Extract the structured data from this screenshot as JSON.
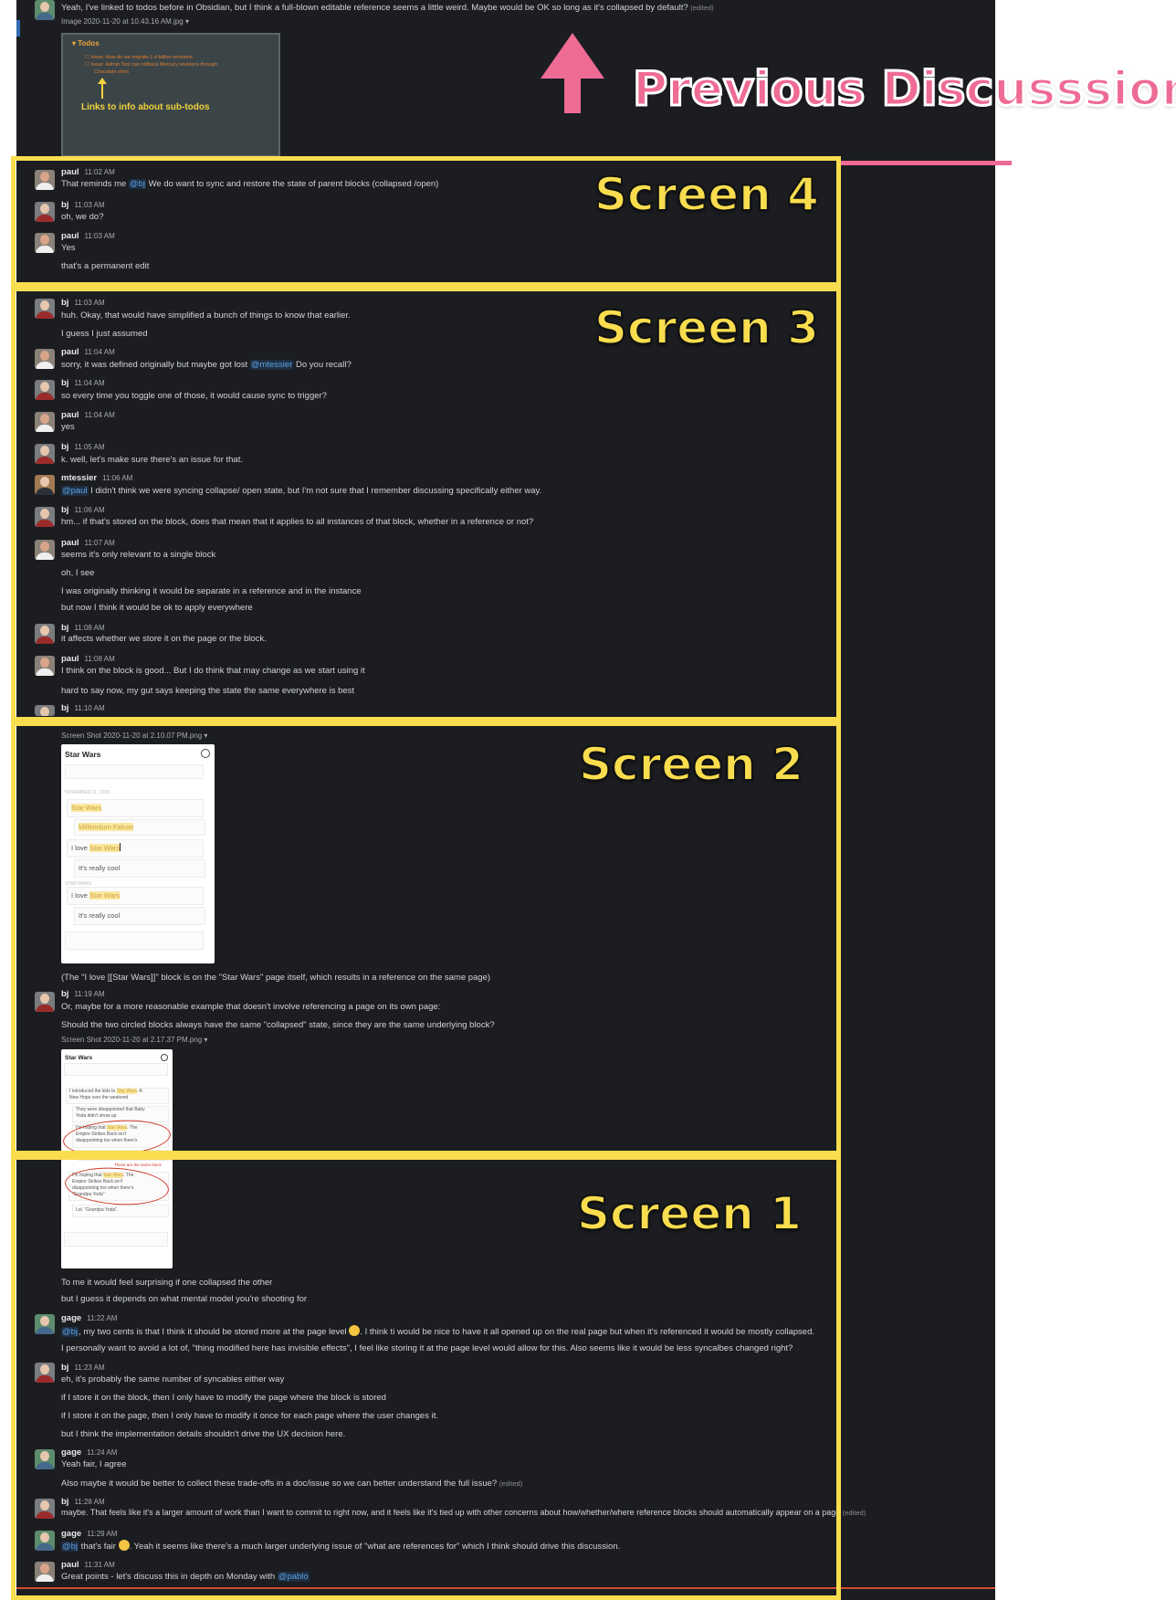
{
  "annotation": {
    "previous_label": "Previous Discusssion",
    "screens": [
      "Screen 4",
      "Screen 3",
      "Screen 2",
      "Screen 1"
    ],
    "colors": {
      "frame": "#f9dd4e",
      "arrow": "#ee6b94",
      "chat_bg": "#1b1d21",
      "mention": "#5aa3e6"
    }
  },
  "top": {
    "message": "Yeah, I've linked to todos before in Obsidian, but I think a full-blown editable reference seems a little weird. Maybe would be OK so long as it's collapsed by default?",
    "edited": "(edited)",
    "filename": "Image 2020-11-20 at 10.43.16 AM.jpg",
    "todo_header": "▾ Todos",
    "todo_line1": "☐ Issue: How do we migrate 1.4 billion revisions",
    "todo_line2": "☐ Issue: Admin Tool can rollback Mercury revisions through",
    "todo_line3": "Chocolate shim",
    "todo_caption": "Links to info about sub-todos"
  },
  "s4": {
    "m1": {
      "name": "paul",
      "time": "11:02 AM",
      "pre": "That reminds me",
      "mention": "@bj",
      "post": "We do want to sync and restore the state of parent blocks (collapsed /open)"
    },
    "m2": {
      "name": "bj",
      "time": "11:03 AM",
      "text": "oh, we do?"
    },
    "m3": {
      "name": "paul",
      "time": "11:03 AM",
      "text": "Yes",
      "text2": "that's a permanent edit"
    }
  },
  "s3": {
    "m1": {
      "name": "bj",
      "time": "11:03 AM",
      "text": "huh. Okay, that would have simplified a bunch of things to know that earlier.",
      "text2": "I guess I just assumed"
    },
    "m2": {
      "name": "paul",
      "time": "11:04 AM",
      "pre": "sorry, it was defined originally but maybe got lost",
      "mention": "@mtessier",
      "post": "Do you recall?"
    },
    "m3": {
      "name": "bj",
      "time": "11:04 AM",
      "text": "so every time you toggle one of those, it would cause sync to trigger?"
    },
    "m4": {
      "name": "paul",
      "time": "11:04 AM",
      "text": "yes"
    },
    "m5": {
      "name": "bj",
      "time": "11:05 AM",
      "text": "k. well, let's make sure there's an issue for that."
    },
    "m6": {
      "name": "mtessier",
      "time": "11:06 AM",
      "mention": "@paul",
      "post": "I didn't think we were syncing collapse/ open state, but I'm not sure that I remember discussing specifically either way."
    },
    "m7": {
      "name": "bj",
      "time": "11:06 AM",
      "text": "hm... if that's stored on the block, does that mean that it applies to all instances of that block, whether in a reference or not?"
    },
    "m8": {
      "name": "paul",
      "time": "11:07 AM",
      "text": "seems it's only relevant to a single block",
      "text2": "oh, I see",
      "text3": "I was originally thinking it would be separate in a reference and in the instance",
      "text4": "but now I think it would be ok to apply everywhere"
    },
    "m9": {
      "name": "bj",
      "time": "11:08 AM",
      "text": "it affects whether we store it on the page or the block."
    },
    "m10": {
      "name": "paul",
      "time": "11:08 AM",
      "text": "I think on the block is good... But I do think that may change as we start using it",
      "text2": "hard to say now, my gut says keeping the state the same everywhere is best"
    },
    "m11": {
      "name": "bj",
      "time": "11:10 AM"
    }
  },
  "s2": {
    "file1": "Screen Shot 2020-11-20 at 2.10.07 PM.png",
    "shot1": {
      "title": "Star Wars",
      "date": "NOVEMBER 11, 2020",
      "r1": "Star Wars",
      "r2": "Millennium Falcon",
      "r3a": "I love ",
      "r3b": "Star Wars",
      "r4": "It's really cool",
      "sub": "STAR WARS",
      "r5a": "I love ",
      "r5b": "Star Wars",
      "r6": "It's really cool"
    },
    "after_text": "(The \"I love [[Star Wars]]\" block is on the \"Star Wars\" page itself, which results in a reference on the same page)",
    "m1": {
      "name": "bj",
      "time": "11:19 AM",
      "text": "Or, maybe for a more reasonable example that doesn't involve referencing a page on its own page:",
      "text2": "Should the two circled blocks always have the same \"collapsed\" state, since they are the same underlying block?"
    },
    "file2": "Screen Shot 2020-11-20 at 2.17.37 PM.png",
    "shot2": {
      "title": "Star Wars",
      "r1a": "I introduced the kids to ",
      "r1b": "Star Wars",
      "r1c": ". A",
      "r1d": "New Hope over the weekend",
      "r2": "They were disappointed that Baby",
      "r2b": "Yoda didn't show up",
      "r3a": "I'm hoping that ",
      "r3b": "Star Wars",
      "r3c": ". The",
      "r3d": "Empire Strikes Back isn't",
      "r3e": "disappointing too when there's",
      "r4": "no \"Grandpa Yoda\"",
      "note": "These are the same block",
      "r5a": "I'm hoping that ",
      "r5b": "Star Wars",
      "r5c": ". The",
      "r5d": "Empire Strikes Back isn't",
      "r5e": "disappointing too when there's",
      "r5f": "\"Grandpa Yoda\"",
      "r6": "Lol. \"Grandpa Yoda\"."
    }
  },
  "s1": {
    "t1": "To me it would feel surprising if one collapsed the other",
    "t2": "but I guess it depends on what mental model you're shooting for",
    "m1": {
      "name": "gage",
      "time": "11:22 AM",
      "mention": "@bj",
      "pre": ", my two cents is that I think it should be stored more at the page level",
      "post": ". I think ti would be nice to have it all opened up on the real page but when it's referenced it would be mostly collapsed.",
      "text2": "I personally want to avoid a lot of, \"thing modified here has invisible effects\", I feel like storing it at the page level would allow for this. Also seems like it would be less syncalbes changed right?"
    },
    "m2": {
      "name": "bj",
      "time": "11:23 AM",
      "text": "eh, it's probably the same number of syncables either way",
      "text2": "if I store it on the block, then I only have to modify the page where the block is stored",
      "text3": "if I store it on the page, then I only have to modify it once for each page where the user changes it.",
      "text4": "but I think the implementation details shouldn't drive the UX decision here."
    },
    "m3": {
      "name": "gage",
      "time": "11:24 AM",
      "text": "Yeah fair, I agree",
      "text2": "Also maybe it would be better to collect these trade-offs in a doc/issue so we can better understand the full issue?",
      "edited": "(edited)"
    },
    "m4": {
      "name": "bj",
      "time": "11:28 AM",
      "text": "maybe. That feels like it's a larger amount of work than I want to commit to right now, and it feels like it's tied up with other concerns about how/whether/where reference blocks should automatically appear on a page",
      "edited": "(edited)"
    },
    "m5": {
      "name": "gage",
      "time": "11:29 AM",
      "mention": "@bj",
      "pre": " that's fair",
      "post": ". Yeah it seems like there's a much larger underlying issue of \"what are references for\" which I think should drive this discussion."
    },
    "m6": {
      "name": "paul",
      "time": "11:31 AM",
      "pre": "Great points - let's discuss this in depth on Monday with",
      "mention": "@pablo"
    }
  }
}
